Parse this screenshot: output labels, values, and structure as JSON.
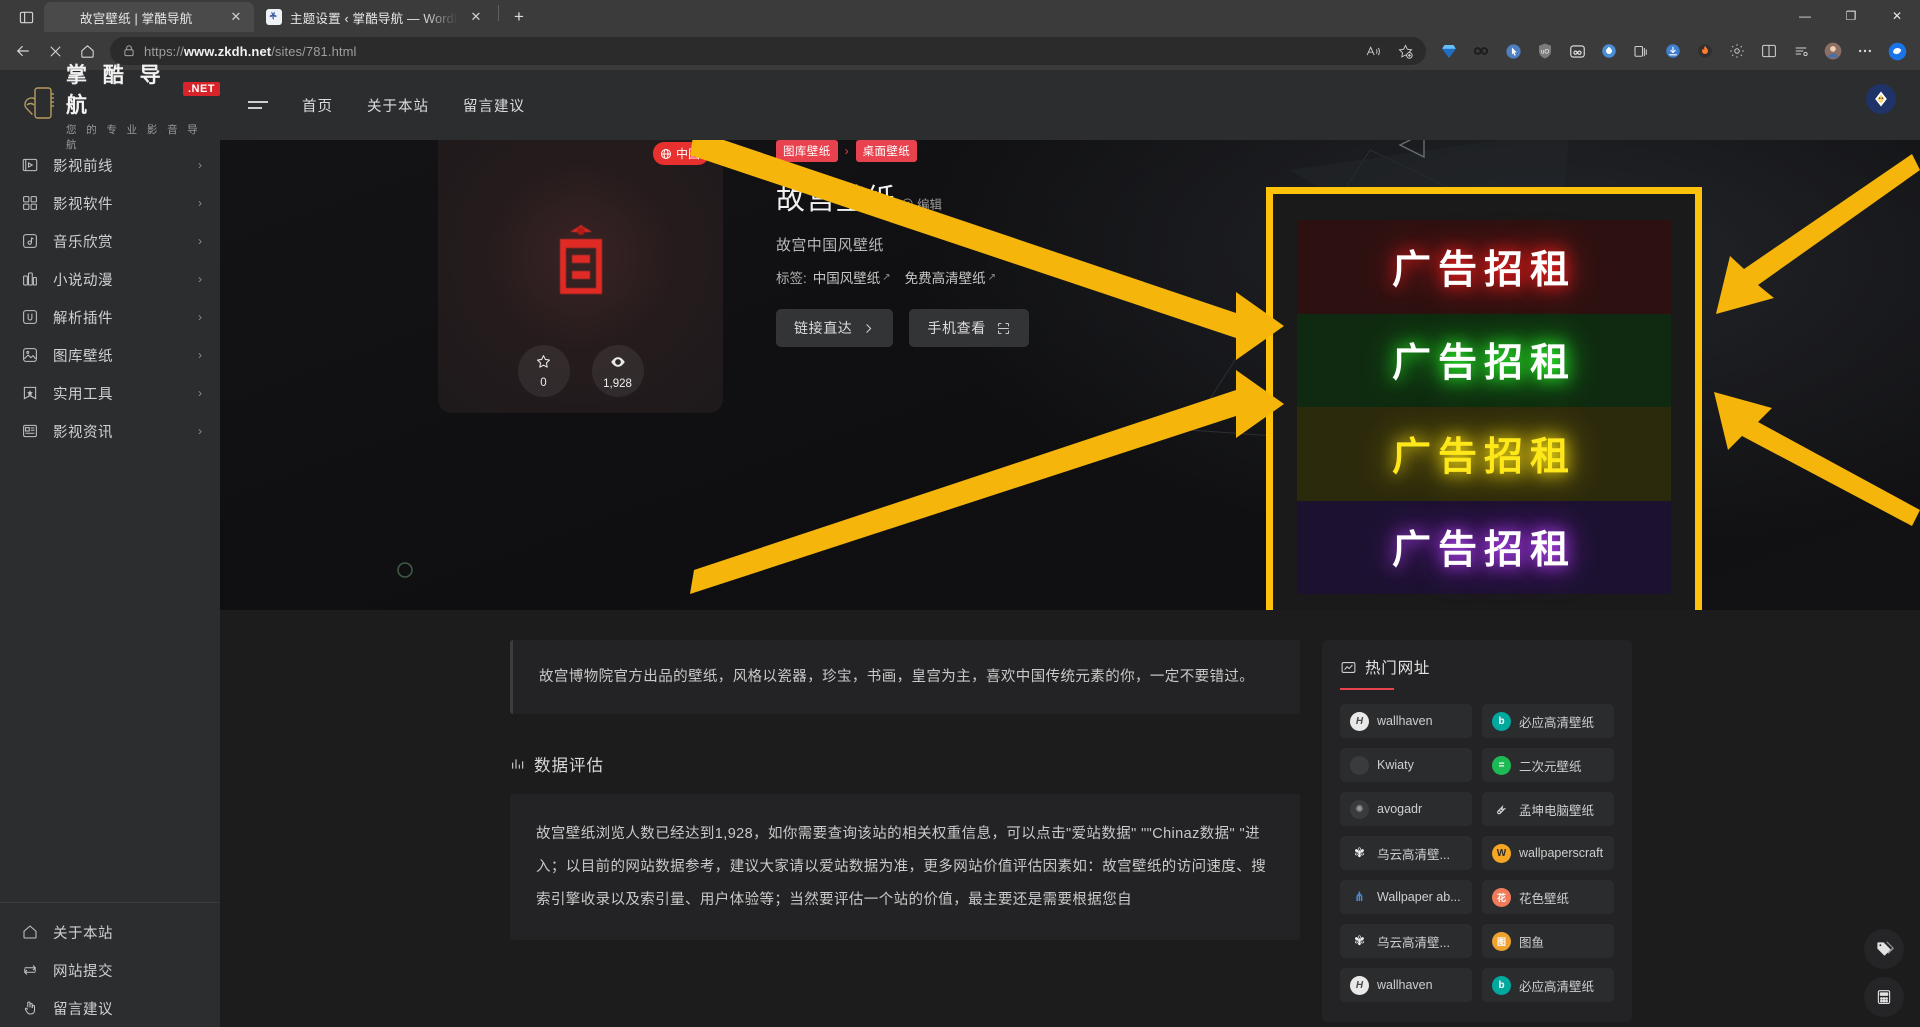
{
  "browser": {
    "tabs": [
      {
        "title": "故宫壁纸 | 掌酷导航",
        "active": true,
        "favicon": ""
      },
      {
        "title": "主题设置 ‹ 掌酷导航 — WordPre",
        "active": false,
        "favicon": "W"
      }
    ],
    "new_tab_label": "+",
    "window_controls": {
      "minimize": "—",
      "maximize": "❐",
      "close": "✕"
    },
    "nav": {
      "back": "←",
      "stop": "✕",
      "home": "⌂"
    },
    "url_secure": "https://www.",
    "url_domain": "www.zkdh.net",
    "url_prefix": "https://",
    "url_path": "/sites/781.html",
    "url_full": "https://www.zkdh.net/sites/781.html",
    "toolbar_icons": [
      "read-aloud-icon",
      "add-favorite-icon",
      "diamond-icon",
      "infinity-icon",
      "cursor-icon",
      "shield-ublock-icon",
      "goo-icon",
      "collections-icon",
      "downloads-icon",
      "extension-flame-icon",
      "settings-gear-icon",
      "split-screen-icon",
      "browser-essentials-icon",
      "profile-avatar-icon",
      "more-icon",
      "copilot-icon"
    ]
  },
  "site": {
    "logo": {
      "main": "掌 酷 导 航",
      "badge": ".NET",
      "sub": "您 的 专 业 影 音 导 航"
    },
    "topnav": [
      {
        "label": "首页"
      },
      {
        "label": "关于本站"
      },
      {
        "label": "留言建议"
      }
    ],
    "sidebar_items": [
      {
        "label": "影视前线",
        "icon": "video-play-icon",
        "arrow": "›"
      },
      {
        "label": "影视软件",
        "icon": "grid-apps-icon",
        "arrow": "›"
      },
      {
        "label": "音乐欣赏",
        "icon": "music-note-icon",
        "arrow": "›"
      },
      {
        "label": "小说动漫",
        "icon": "book-bars-icon",
        "arrow": "›"
      },
      {
        "label": "解析插件",
        "icon": "plugin-icon",
        "arrow": "›"
      },
      {
        "label": "图库壁纸",
        "icon": "image-picture-icon",
        "arrow": "›"
      },
      {
        "label": "实用工具",
        "icon": "star-tool-icon",
        "arrow": "›"
      },
      {
        "label": "影视资讯",
        "icon": "news-icon",
        "arrow": "›"
      }
    ],
    "sidebar_bottom_items": [
      {
        "label": "关于本站",
        "icon": "home-icon"
      },
      {
        "label": "网站提交",
        "icon": "submit-loop-icon"
      },
      {
        "label": "留言建议",
        "icon": "hand-click-icon"
      }
    ]
  },
  "detail": {
    "breadcrumbs": [
      {
        "label": "图库壁纸"
      },
      {
        "label": "桌面壁纸"
      }
    ],
    "breadcrumb_sep": "›",
    "title": "故宫壁纸",
    "edit_label": "编辑",
    "description": "故宫中国风壁纸",
    "tags_label": "标签:",
    "tags": [
      {
        "label": "中国风壁纸"
      },
      {
        "label": "免费高清壁纸"
      }
    ],
    "buttons": [
      {
        "label": "链接直达",
        "icon": "chevron-right-icon"
      },
      {
        "label": "手机查看",
        "icon": "qr-scan-icon"
      }
    ],
    "card": {
      "country_badge": "中国",
      "country_icon": "globe-icon",
      "favorites_count": "0",
      "favorites_icon": "star-icon",
      "views_count": "1,928",
      "views_icon": "eye-icon"
    }
  },
  "ad": {
    "bands": [
      {
        "text": "广告招租",
        "color": "#ff1e1e",
        "bg": "#2d1111"
      },
      {
        "text": "广告招租",
        "color": "#2aff2a",
        "bg": "#0f2a10"
      },
      {
        "text": "广告招租",
        "color": "#ffe81a",
        "bg": "#2c2a0c"
      },
      {
        "text": "广告招租",
        "color": "#c04bff",
        "bg": "#1c1230"
      }
    ],
    "border_color": "#ffc20a"
  },
  "article": {
    "quote": "故宫博物院官方出品的壁纸，风格以瓷器，珍宝，书画，皇宫为主，喜欢中国传统元素的你，一定不要错过。",
    "section_title": "数据评估",
    "section_icon": "chart-icon",
    "body": "故宫壁纸浏览人数已经达到1,928，如你需要查询该站的相关权重信息，可以点击\"爱站数据\" \"\"Chinaz数据\" \"进入；以目前的网站数据参考，建议大家请以爱站数据为准，更多网站价值评估因素如：故宫壁纸的访问速度、搜索引擎收录以及索引量、用户体验等；当然要评估一个站的价值，最主要还是需要根据您自"
  },
  "rail": {
    "title": "热门网址",
    "title_icon": "trend-chart-icon",
    "items": [
      {
        "label": "wallhaven",
        "icon": "H",
        "ic_bg": "#e9e9e9",
        "ic_fg": "#4a4a4a"
      },
      {
        "label": "必应高清壁纸",
        "icon": "b",
        "ic_bg": "#00a99d",
        "ic_fg": "#ffffff"
      },
      {
        "label": "Kwiaty",
        "icon": "",
        "ic_bg": "#3a3b3d",
        "ic_fg": "#cccccc"
      },
      {
        "label": "二次元壁纸",
        "icon": "=",
        "ic_bg": "#1db954",
        "ic_fg": "#ffffff"
      },
      {
        "label": "avogadr",
        "icon": "✺",
        "ic_bg": "#3a3b3d",
        "ic_fg": "#9b9b9b"
      },
      {
        "label": "孟坤电脑壁纸",
        "icon": "🜸",
        "ic_bg": "transparent",
        "ic_fg": "#d4d4d4"
      },
      {
        "label": "乌云高清壁...",
        "icon": "✾",
        "ic_bg": "transparent",
        "ic_fg": "#f0f0f0"
      },
      {
        "label": "wallpaperscraft",
        "icon": "W",
        "ic_bg": "#f5a623",
        "ic_fg": "#2b2b2b"
      },
      {
        "label": "Wallpaper ab...",
        "icon": "⋔",
        "ic_bg": "transparent",
        "ic_fg": "#4a90d9"
      },
      {
        "label": "花色壁纸",
        "icon": "花",
        "ic_bg": "#ef7b5a",
        "ic_fg": "#ffffff"
      },
      {
        "label": "乌云高清壁...",
        "icon": "✾",
        "ic_bg": "transparent",
        "ic_fg": "#f0f0f0"
      },
      {
        "label": "图鱼",
        "icon": "图",
        "ic_bg": "#f0a22e",
        "ic_fg": "#ffffff"
      },
      {
        "label": "wallhaven",
        "icon": "H",
        "ic_bg": "#e9e9e9",
        "ic_fg": "#4a4a4a"
      },
      {
        "label": "必应高清壁纸",
        "icon": "b",
        "ic_bg": "#00a99d",
        "ic_fg": "#ffffff"
      }
    ]
  },
  "float_buttons": [
    {
      "name": "tags-icon"
    },
    {
      "name": "calculator-icon"
    }
  ],
  "theme_toggle": {
    "icon": "diamond-theme-icon"
  }
}
